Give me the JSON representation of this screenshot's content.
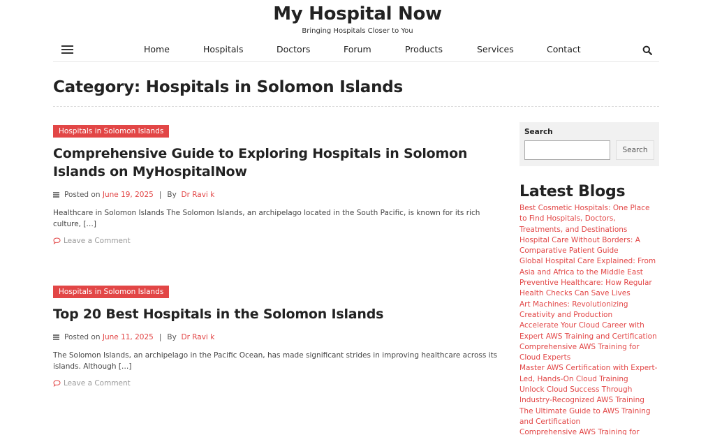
{
  "site": {
    "title": "My Hospital Now",
    "tagline": "Bringing Hospitals Closer to You"
  },
  "nav": {
    "items": [
      "Home",
      "Hospitals",
      "Doctors",
      "Forum",
      "Products",
      "Services",
      "Contact"
    ]
  },
  "page": {
    "category_title": "Category: Hospitals in Solomon Islands"
  },
  "posts": [
    {
      "category": "Hospitals in Solomon Islands",
      "title": "Comprehensive Guide to Exploring Hospitals in Solomon Islands on MyHospitalNow",
      "posted_on_label": "Posted on",
      "date": "June 19, 2025",
      "sep": "|",
      "by_label": "By",
      "author": "Dr Ravi k",
      "excerpt": "Healthcare in Solomon Islands The Solomon Islands, an archipelago located in the South Pacific, is known for its rich culture, […]",
      "comment_label": "Leave a Comment"
    },
    {
      "category": "Hospitals in Solomon Islands",
      "title": "Top 20 Best Hospitals in the Solomon Islands",
      "posted_on_label": "Posted on",
      "date": "June 11, 2025",
      "sep": "|",
      "by_label": "By",
      "author": "Dr Ravi k",
      "excerpt": "The Solomon Islands, an archipelago in the Pacific Ocean, has made significant strides in improving healthcare across its islands. Although […]",
      "comment_label": "Leave a Comment"
    }
  ],
  "sidebar": {
    "search_label": "Search",
    "search_value": "",
    "search_button": "Search",
    "latest_title": "Latest Blogs",
    "blogs": [
      "Best Cosmetic Hospitals: One Place to Find Hospitals, Doctors, Treatments, and Destinations",
      "Hospital Care Without Borders: A Comparative Patient Guide",
      "Global Hospital Care Explained: From Asia and Africa to the Middle East",
      "Preventive Healthcare: How Regular Health Checks Can Save Lives",
      "Art Machines: Revolutionizing Creativity and Production",
      "Accelerate Your Cloud Career with Expert AWS Training and Certification",
      "Comprehensive AWS Training for Cloud Experts",
      "Master AWS Certification with Expert-Led, Hands-On Cloud Training",
      "Unlock Cloud Success Through Industry-Recognized AWS Training",
      "The Ultimate Guide to AWS Training and Certification",
      "Comprehensive AWS Training for"
    ]
  },
  "colors": {
    "accent": "#e24646",
    "text": "#222222"
  },
  "icons": {
    "menu": "hamburger-icon",
    "search": "search-icon",
    "meta": "list-icon",
    "comment": "comment-icon"
  }
}
